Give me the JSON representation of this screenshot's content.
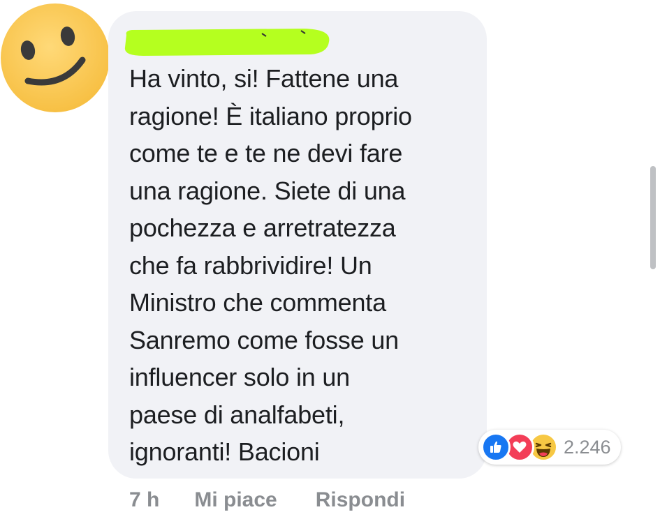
{
  "comment": {
    "lines": [
      "Ha vinto, si! Fattene una",
      "ragione! È italiano proprio",
      "come te e te ne devi fare",
      "una ragione. Siete di una",
      "pochezza e arretratezza",
      "che fa rabbrividire! Un",
      "Ministro che commenta",
      "Sanremo come fosse un",
      "influencer solo in un",
      "paese di analfabeti,",
      "ignoranti! Bacioni"
    ],
    "bubble_color": "#f1f2f6",
    "redaction_color": "#b5ff1f"
  },
  "reactions": {
    "icons": [
      "like-icon",
      "love-icon",
      "haha-icon"
    ],
    "count": "2.246",
    "colors": {
      "like": "#1877f2",
      "love": "#f33e58",
      "haha": "#f7c844"
    }
  },
  "actions": {
    "time": "7 h",
    "like_label": "Mi piace",
    "reply_label": "Rispondi"
  }
}
